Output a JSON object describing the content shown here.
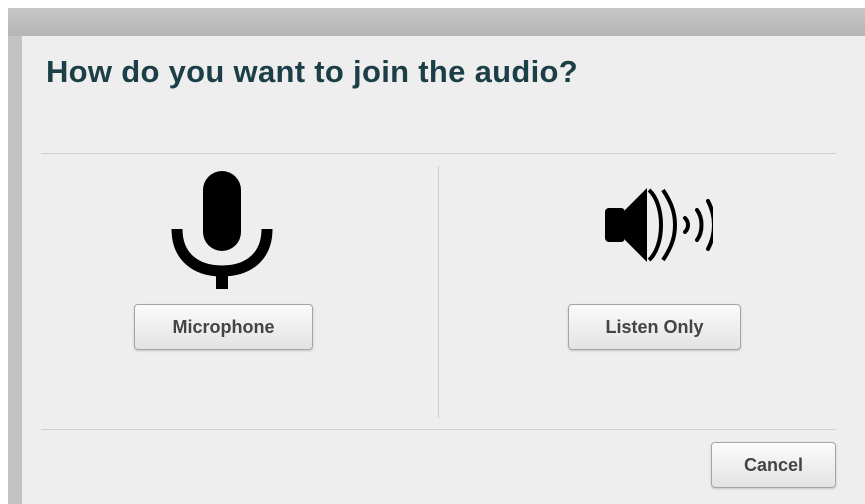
{
  "dialog": {
    "title": "How do you want to join the audio?"
  },
  "options": {
    "microphone": {
      "icon": "microphone-icon",
      "label": "Microphone"
    },
    "listen_only": {
      "icon": "speaker-icon",
      "label": "Listen Only"
    }
  },
  "footer": {
    "cancel_label": "Cancel"
  },
  "colors": {
    "title": "#1c3f47",
    "dialog_bg": "#eeeeee",
    "icon": "#000000"
  }
}
